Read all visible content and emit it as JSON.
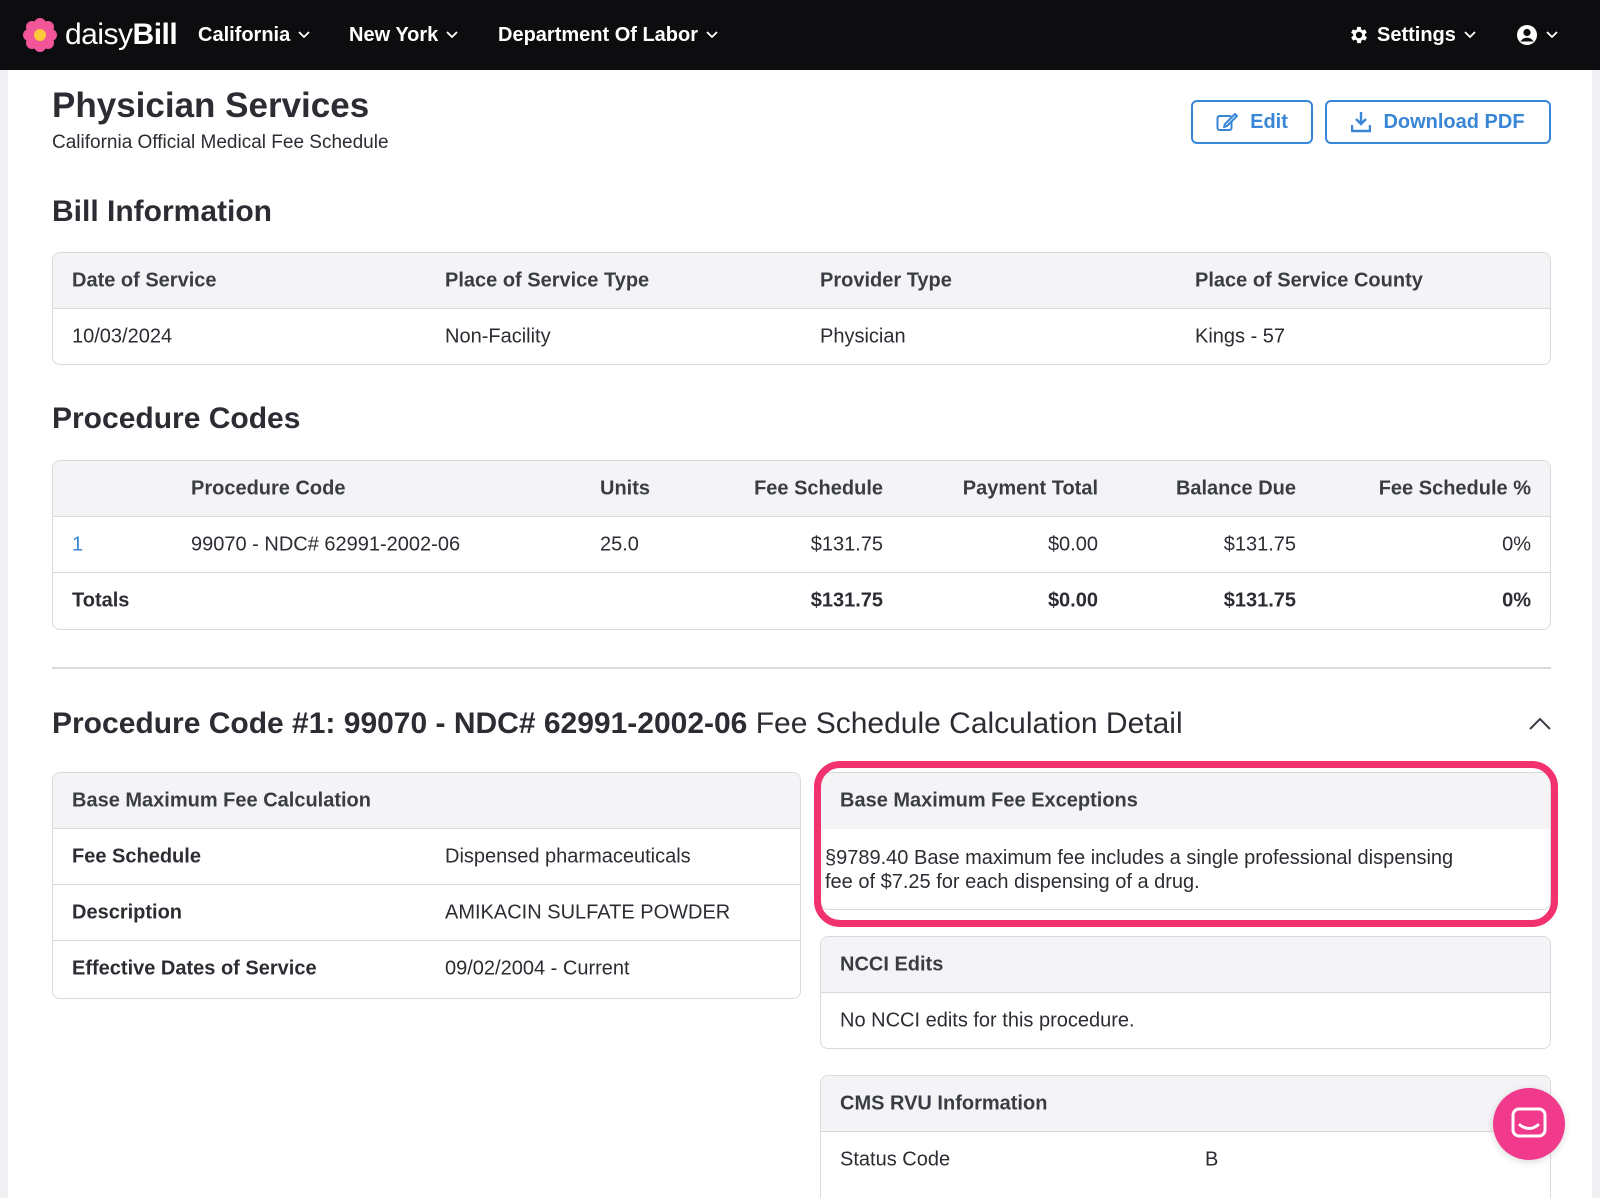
{
  "nav": {
    "brand_light": "daisy",
    "brand_bold": "Bill",
    "items": [
      "California",
      "New York",
      "Department Of Labor"
    ],
    "settings": "Settings",
    "logo_icon": "daisy-flower-icon",
    "user_icon": "user-circle-icon"
  },
  "page": {
    "title": "Physician Services",
    "subtitle": "California Official Medical Fee Schedule",
    "edit_label": "Edit",
    "download_label": "Download PDF"
  },
  "bill_info": {
    "title": "Bill Information",
    "headers": [
      "Date of Service",
      "Place of Service Type",
      "Provider Type",
      "Place of Service County"
    ],
    "values": [
      "10/03/2024",
      "Non-Facility",
      "Physician",
      "Kings - 57"
    ]
  },
  "procedure_codes": {
    "title": "Procedure Codes",
    "headers": [
      "",
      "Procedure Code",
      "Units",
      "Fee Schedule",
      "Payment Total",
      "Balance Due",
      "Fee Schedule %"
    ],
    "rows": [
      [
        "1",
        "99070 - NDC# 62991-2002-06",
        "25.0",
        "$131.75",
        "$0.00",
        "$131.75",
        "0%"
      ]
    ],
    "totals": [
      "Totals",
      "",
      "",
      "$131.75",
      "$0.00",
      "$131.75",
      "0%"
    ]
  },
  "detail": {
    "title_bold": "Procedure Code #1: 99070 - NDC# 62991-2002-06",
    "title_rest": " Fee Schedule Calculation Detail",
    "base_fee": {
      "title": "Base Maximum Fee Calculation",
      "rows": [
        [
          "Fee Schedule",
          "Dispensed pharmaceuticals"
        ],
        [
          "Description",
          "AMIKACIN SULFATE POWDER"
        ],
        [
          "Effective Dates of Service",
          "09/02/2004 - Current"
        ]
      ]
    },
    "exceptions": {
      "title": "Base Maximum Fee Exceptions",
      "line1": "§9789.40 Base maximum fee includes a single professional dispensing",
      "line2": "fee of $7.25 for each dispensing of a drug."
    },
    "ncci": {
      "title": "NCCI Edits",
      "text": "No NCCI edits for this procedure."
    },
    "cms": {
      "title": "CMS RVU Information",
      "rows": [
        [
          "Status Code",
          "B"
        ]
      ]
    }
  },
  "colors": {
    "accent": "#3a86d6",
    "highlight": "#f2326e",
    "nav_bg": "#0d0d0f",
    "chat": "#f23a8c"
  }
}
